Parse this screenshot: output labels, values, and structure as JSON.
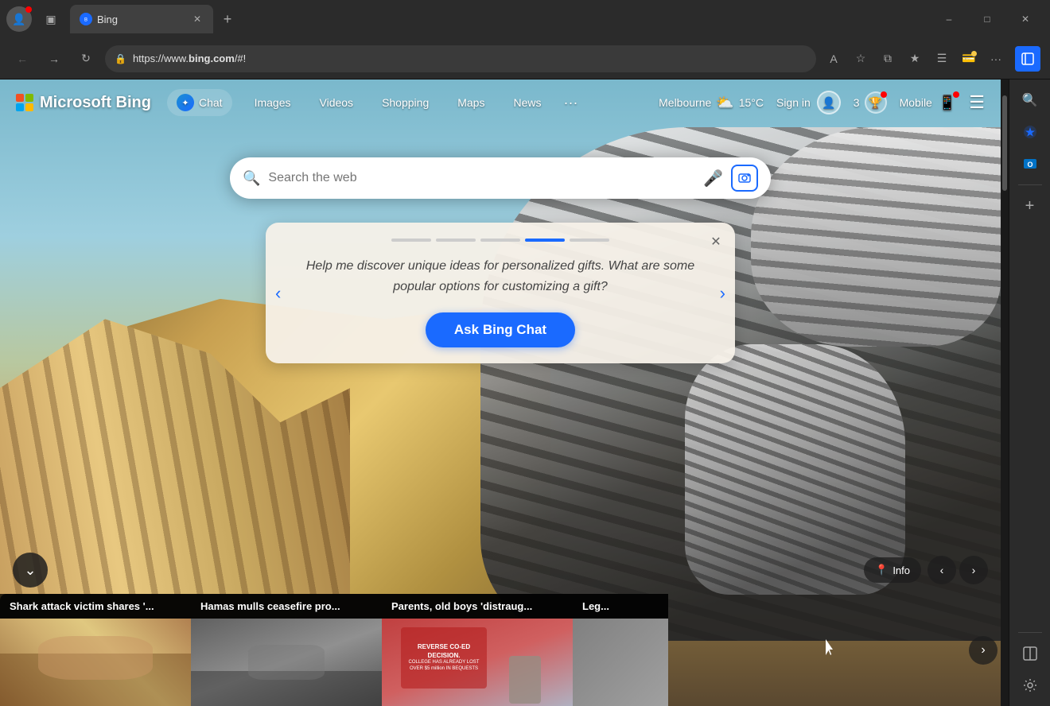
{
  "browser": {
    "url": "https://www.bing.com/#!",
    "url_display": {
      "prefix": "https://www.",
      "bold": "bing.com",
      "suffix": "/#!"
    },
    "tab": {
      "title": "Bing",
      "favicon_color": "#1a6aff"
    },
    "window_controls": {
      "minimize": "–",
      "maximize": "□",
      "close": "✕"
    }
  },
  "bing": {
    "logo_text": "Microsoft Bing",
    "nav_items": [
      {
        "label": "Chat",
        "id": "chat"
      },
      {
        "label": "Images",
        "id": "images"
      },
      {
        "label": "Videos",
        "id": "videos"
      },
      {
        "label": "Shopping",
        "id": "shopping"
      },
      {
        "label": "Maps",
        "id": "maps"
      },
      {
        "label": "News",
        "id": "news"
      },
      {
        "label": "...",
        "id": "more"
      }
    ],
    "weather": {
      "city": "Melbourne",
      "icon": "⛅",
      "temp": "15°C"
    },
    "sign_in": "Sign in",
    "rewards_count": "3",
    "mobile_label": "Mobile",
    "search_placeholder": "Search the web",
    "promo_card": {
      "text": "Help me discover unique ideas for personalized gifts. What are some popular options for customizing a gift?",
      "button_label": "Ask Bing Chat",
      "dots": [
        {
          "active": false
        },
        {
          "active": false
        },
        {
          "active": false
        },
        {
          "active": true
        },
        {
          "active": false
        }
      ]
    },
    "news": [
      {
        "headline": "Shark attack victim shares '...",
        "img_colors": [
          "#8a6040",
          "#c09060",
          "#d4a870"
        ]
      },
      {
        "headline": "Hamas mulls ceasefire pro...",
        "img_colors": [
          "#606060",
          "#808080",
          "#404040"
        ]
      },
      {
        "headline": "Parents, old boys 'distraug...",
        "img_colors": [
          "#c04040",
          "#e06060",
          "#b0b0b0"
        ]
      },
      {
        "headline": "Leg...",
        "img_colors": [
          "#808080",
          "#a0a0a0",
          "#606060"
        ]
      }
    ],
    "info_label": "Info",
    "location_icon": "📍"
  },
  "sidebar_right": {
    "icons": [
      {
        "name": "search",
        "symbol": "🔍"
      },
      {
        "name": "copilot",
        "symbol": "✦"
      },
      {
        "name": "outlook",
        "symbol": "📧"
      },
      {
        "name": "plus",
        "symbol": "+"
      }
    ],
    "bottom_icons": [
      {
        "name": "split-screen",
        "symbol": "⧉"
      },
      {
        "name": "settings",
        "symbol": "⚙"
      }
    ]
  }
}
